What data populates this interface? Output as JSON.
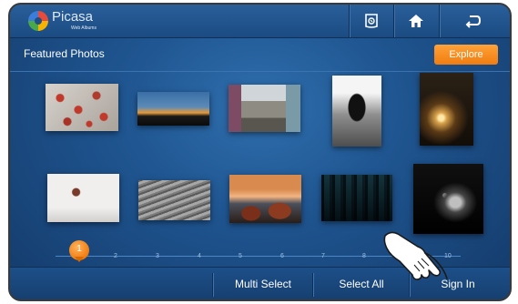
{
  "app": {
    "name": "Picasa",
    "subtitle": "Web Albums"
  },
  "toolbar": {
    "icons": [
      "phone-app-icon",
      "home-icon",
      "back-icon"
    ]
  },
  "section": {
    "title": "Featured Photos"
  },
  "explore_label": "Explore",
  "photos": [
    {
      "name": "red-berries-photo"
    },
    {
      "name": "city-sunset-skyline-photo"
    },
    {
      "name": "street-scene-photo"
    },
    {
      "name": "penguin-on-rocks-photo"
    },
    {
      "name": "lamp-glow-dark-photo"
    },
    {
      "name": "balloon-fog-photo"
    },
    {
      "name": "bird-flock-photo"
    },
    {
      "name": "rocky-shore-sunset-photo"
    },
    {
      "name": "misty-forest-photo"
    },
    {
      "name": "black-cat-photo"
    }
  ],
  "pager": {
    "current": "1",
    "pages": [
      "2",
      "3",
      "4",
      "5",
      "6",
      "7",
      "8",
      "9",
      "10"
    ]
  },
  "bottom": {
    "multi_select": "Multi Select",
    "select_all": "Select All",
    "sign_in": "Sign In"
  },
  "colors": {
    "accent": "#f58a1f",
    "background": "#1f5590"
  }
}
